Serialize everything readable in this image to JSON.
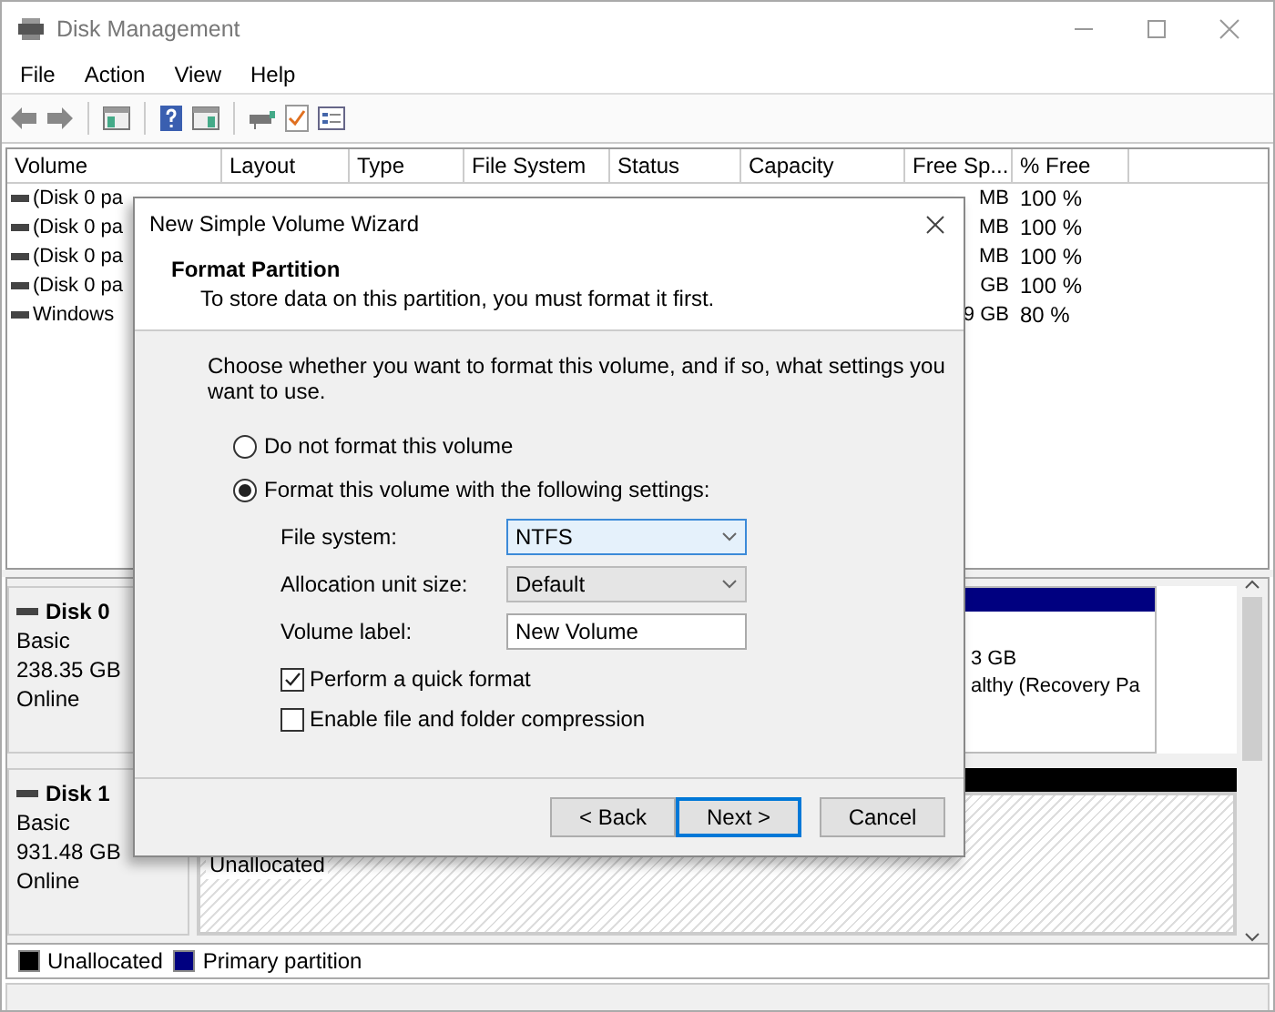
{
  "window": {
    "title": "Disk Management"
  },
  "menu": [
    {
      "label": "File"
    },
    {
      "label": "Action"
    },
    {
      "label": "View"
    },
    {
      "label": "Help"
    }
  ],
  "volume_table": {
    "columns": [
      "Volume",
      "Layout",
      "Type",
      "File System",
      "Status",
      "Capacity",
      "Free Sp...",
      "% Free"
    ],
    "rows": [
      {
        "volume": "(Disk 0 pa",
        "free_space": "MB",
        "percent_free": "100 %"
      },
      {
        "volume": "(Disk 0 pa",
        "free_space": "MB",
        "percent_free": "100 %"
      },
      {
        "volume": "(Disk 0 pa",
        "free_space": "MB",
        "percent_free": "100 %"
      },
      {
        "volume": "(Disk 0 pa",
        "free_space": "GB",
        "percent_free": "100 %"
      },
      {
        "volume": "Windows",
        "free_space": "9 GB",
        "percent_free": "80 %"
      }
    ]
  },
  "disks": [
    {
      "name": "Disk 0",
      "type": "Basic",
      "size": "238.35 GB",
      "status": "Online",
      "partitions": [
        {
          "kind": "primary",
          "lines": [
            "3 GB",
            "althy (Recovery Pa"
          ]
        }
      ]
    },
    {
      "name": "Disk 1",
      "type": "Basic",
      "size": "931.48 GB",
      "status": "Online",
      "partitions": [
        {
          "kind": "unallocated",
          "lines": [
            "Unallocated"
          ]
        }
      ]
    }
  ],
  "legend": [
    {
      "label": "Unallocated",
      "color": "#000000"
    },
    {
      "label": "Primary partition",
      "color": "#000080"
    }
  ],
  "dialog": {
    "title": "New Simple Volume Wizard",
    "heading": "Format Partition",
    "subheading": "To store data on this partition, you must format it first.",
    "prompt": "Choose whether you want to format this volume, and if so, what settings you want to use.",
    "options": [
      {
        "label": "Do not format this volume",
        "selected": false
      },
      {
        "label": "Format this volume with the following settings:",
        "selected": true
      }
    ],
    "fields": [
      {
        "label": "File system:",
        "kind": "select",
        "value": "NTFS",
        "focused": true
      },
      {
        "label": "Allocation unit size:",
        "kind": "select",
        "value": "Default",
        "focused": false
      },
      {
        "label": "Volume label:",
        "kind": "text",
        "value": "New Volume",
        "focused": false
      }
    ],
    "checkboxes": [
      {
        "label": "Perform a quick format",
        "checked": true
      },
      {
        "label": "Enable file and folder compression",
        "checked": false
      }
    ],
    "buttons": [
      {
        "label": "< Back",
        "default": false
      },
      {
        "label": "Next >",
        "default": true
      },
      {
        "label": "Cancel",
        "default": false
      }
    ]
  }
}
